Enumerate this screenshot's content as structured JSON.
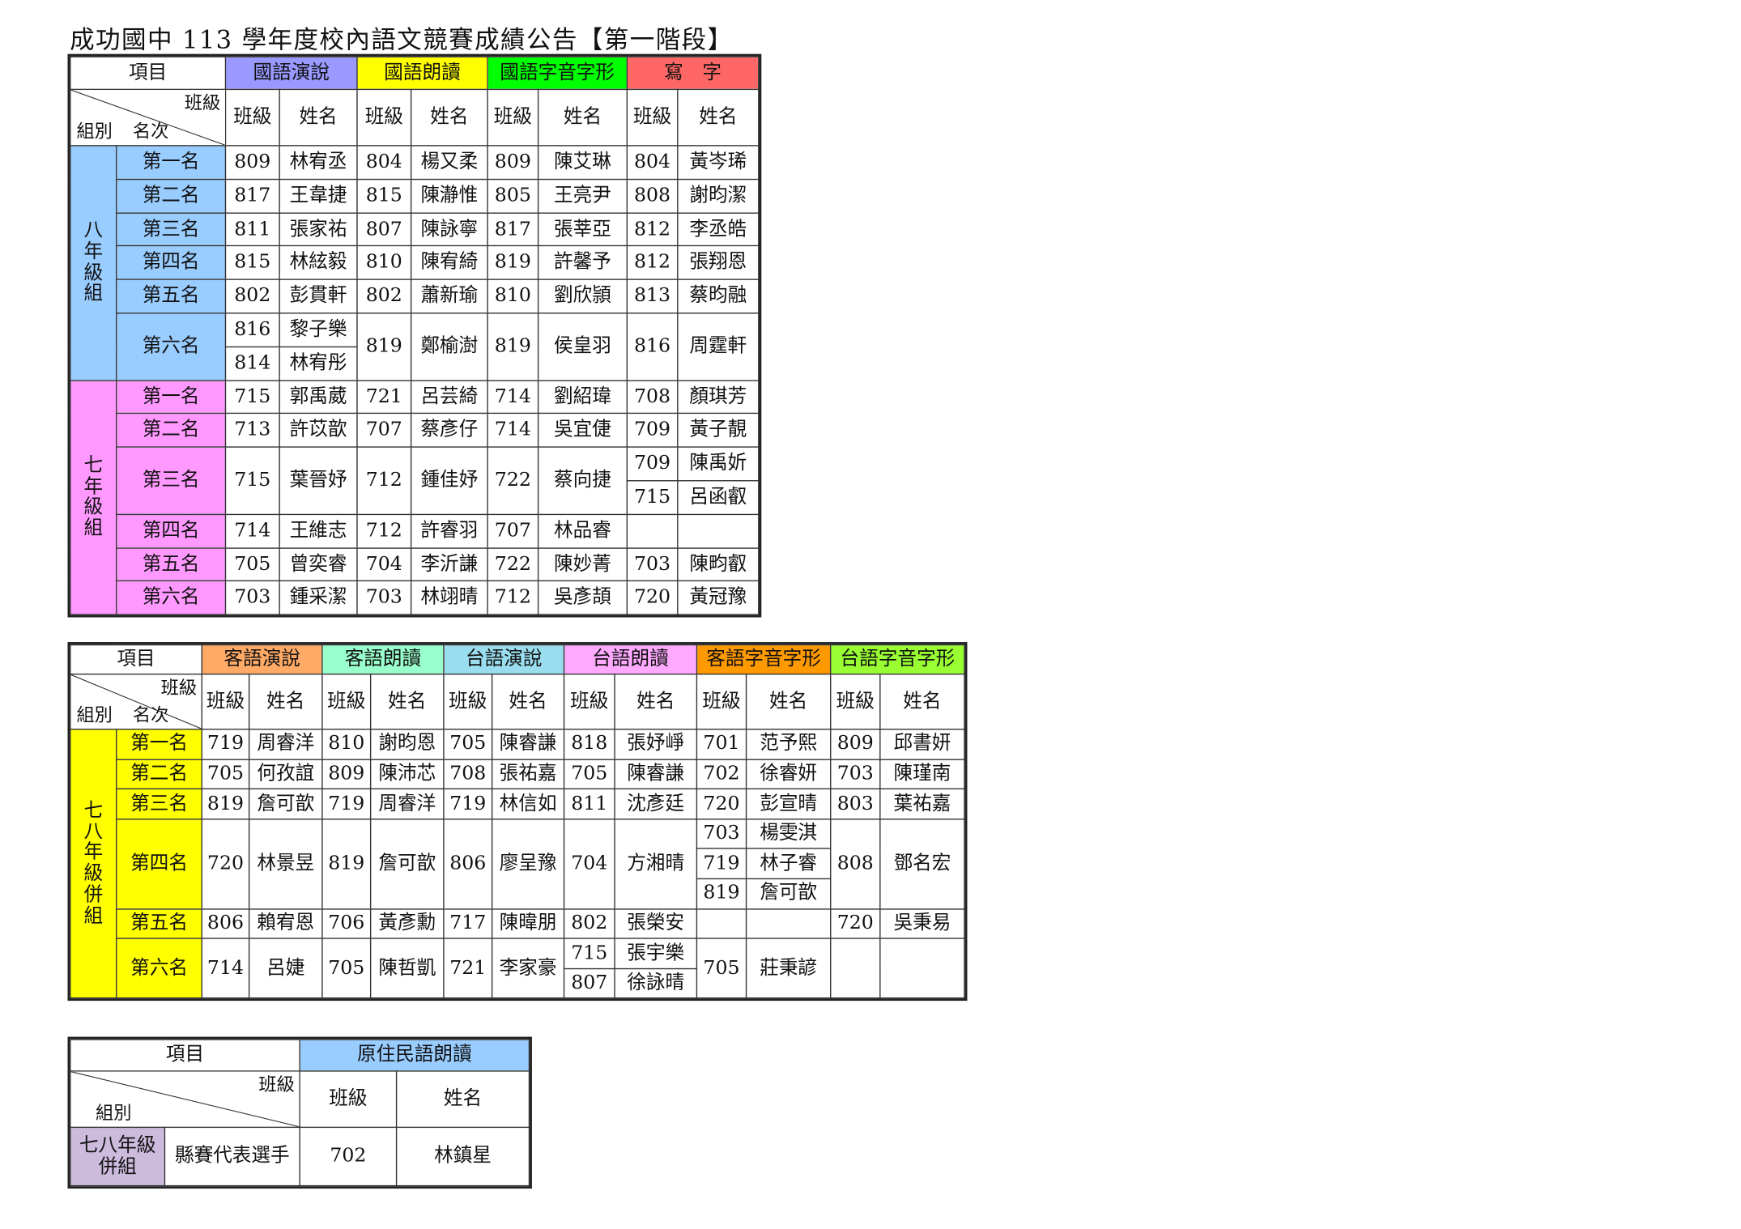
{
  "title": "成功國中 113 學年度校內語文競賽成績公告【第一階段】",
  "table1": {
    "project_label": "項目",
    "class_label": "班級",
    "group_label": "組別",
    "rank_label": "名次",
    "name_label": "姓名",
    "categories": [
      {
        "name": "國語演說",
        "color": "#9999ff"
      },
      {
        "name": "國語朗讀",
        "color": "#ffff00"
      },
      {
        "name": "國語字音字形",
        "color": "#00ff00"
      },
      {
        "name": "寫　字",
        "color": "#ff6666"
      }
    ],
    "groups": [
      {
        "name": "八年級組",
        "color": "#99ccff",
        "ranks": [
          {
            "rank": "第一名",
            "entries": [
              [
                [
                  "809",
                  "林宥丞"
                ]
              ],
              [
                [
                  "804",
                  "楊又柔"
                ]
              ],
              [
                [
                  "809",
                  "陳艾琳"
                ]
              ],
              [
                [
                  "804",
                  "黃岑琋"
                ]
              ]
            ]
          },
          {
            "rank": "第二名",
            "entries": [
              [
                [
                  "817",
                  "王韋捷"
                ]
              ],
              [
                [
                  "815",
                  "陳瀞惟"
                ]
              ],
              [
                [
                  "805",
                  "王亮尹"
                ]
              ],
              [
                [
                  "808",
                  "謝昀潔"
                ]
              ]
            ]
          },
          {
            "rank": "第三名",
            "entries": [
              [
                [
                  "811",
                  "張家祐"
                ]
              ],
              [
                [
                  "807",
                  "陳詠寧"
                ]
              ],
              [
                [
                  "817",
                  "張莘亞"
                ]
              ],
              [
                [
                  "812",
                  "李丞皓"
                ]
              ]
            ]
          },
          {
            "rank": "第四名",
            "entries": [
              [
                [
                  "815",
                  "林絃毅"
                ]
              ],
              [
                [
                  "810",
                  "陳宥綺"
                ]
              ],
              [
                [
                  "819",
                  "許馨予"
                ]
              ],
              [
                [
                  "812",
                  "張翔恩"
                ]
              ]
            ]
          },
          {
            "rank": "第五名",
            "entries": [
              [
                [
                  "802",
                  "彭貫軒"
                ]
              ],
              [
                [
                  "802",
                  "蕭新瑜"
                ]
              ],
              [
                [
                  "810",
                  "劉欣頴"
                ]
              ],
              [
                [
                  "813",
                  "蔡昀融"
                ]
              ]
            ]
          },
          {
            "rank": "第六名",
            "entries": [
              [
                [
                  "816",
                  "黎子樂"
                ],
                [
                  "814",
                  "林宥彤"
                ]
              ],
              [
                [
                  "819",
                  "鄭榆澍"
                ]
              ],
              [
                [
                  "819",
                  "侯皇羽"
                ]
              ],
              [
                [
                  "816",
                  "周霆軒"
                ]
              ]
            ]
          }
        ]
      },
      {
        "name": "七年級組",
        "color": "#ff99ff",
        "ranks": [
          {
            "rank": "第一名",
            "entries": [
              [
                [
                  "715",
                  "郭禹葳"
                ]
              ],
              [
                [
                  "721",
                  "呂芸綺"
                ]
              ],
              [
                [
                  "714",
                  "劉紹瑋"
                ]
              ],
              [
                [
                  "708",
                  "顏琪芳"
                ]
              ]
            ]
          },
          {
            "rank": "第二名",
            "entries": [
              [
                [
                  "713",
                  "許苡歆"
                ]
              ],
              [
                [
                  "707",
                  "蔡彥仔"
                ]
              ],
              [
                [
                  "714",
                  "吳宜倢"
                ]
              ],
              [
                [
                  "709",
                  "黃子靚"
                ]
              ]
            ]
          },
          {
            "rank": "第三名",
            "entries": [
              [
                [
                  "715",
                  "葉晉妤"
                ]
              ],
              [
                [
                  "712",
                  "鍾佳妤"
                ]
              ],
              [
                [
                  "722",
                  "蔡向捷"
                ]
              ],
              [
                [
                  "709",
                  "陳禹妡"
                ],
                [
                  "715",
                  "呂函叡"
                ]
              ]
            ]
          },
          {
            "rank": "第四名",
            "entries": [
              [
                [
                  "714",
                  "王維志"
                ]
              ],
              [
                [
                  "712",
                  "許睿羽"
                ]
              ],
              [
                [
                  "707",
                  "林品睿"
                ]
              ],
              [
                [
                  "",
                  ""
                ]
              ]
            ]
          },
          {
            "rank": "第五名",
            "entries": [
              [
                [
                  "705",
                  "曾奕睿"
                ]
              ],
              [
                [
                  "704",
                  "李沂謙"
                ]
              ],
              [
                [
                  "722",
                  "陳妙菁"
                ]
              ],
              [
                [
                  "703",
                  "陳畇叡"
                ]
              ]
            ]
          },
          {
            "rank": "第六名",
            "entries": [
              [
                [
                  "703",
                  "鍾采潔"
                ]
              ],
              [
                [
                  "703",
                  "林翊晴"
                ]
              ],
              [
                [
                  "712",
                  "吳彥頡"
                ]
              ],
              [
                [
                  "720",
                  "黃冠豫"
                ]
              ]
            ]
          }
        ]
      }
    ]
  },
  "table2": {
    "project_label": "項目",
    "class_label": "班級",
    "group_label": "組別",
    "rank_label": "名次",
    "name_label": "姓名",
    "categories": [
      {
        "name": "客語演說",
        "color": "#ffaa66"
      },
      {
        "name": "客語朗讀",
        "color": "#99ffcc"
      },
      {
        "name": "台語演說",
        "color": "#99ddee"
      },
      {
        "name": "台語朗讀",
        "color": "#ffaaff"
      },
      {
        "name": "客語字音字形",
        "color": "#ff9900"
      },
      {
        "name": "台語字音字形",
        "color": "#99ff33"
      }
    ],
    "group": {
      "name": "七八年級併組",
      "color": "#ffff00",
      "ranks": [
        {
          "rank": "第一名",
          "entries": [
            [
              [
                "719",
                "周睿洋"
              ]
            ],
            [
              [
                "810",
                "謝昀恩"
              ]
            ],
            [
              [
                "705",
                "陳睿謙"
              ]
            ],
            [
              [
                "818",
                "張妤崢"
              ]
            ],
            [
              [
                "701",
                "范予熙"
              ]
            ],
            [
              [
                "809",
                "邱書妍"
              ]
            ]
          ]
        },
        {
          "rank": "第二名",
          "entries": [
            [
              [
                "705",
                "何孜誼"
              ]
            ],
            [
              [
                "809",
                "陳沛芯"
              ]
            ],
            [
              [
                "708",
                "張祐嘉"
              ]
            ],
            [
              [
                "705",
                "陳睿謙"
              ]
            ],
            [
              [
                "702",
                "徐睿妍"
              ]
            ],
            [
              [
                "703",
                "陳瑾南"
              ]
            ]
          ]
        },
        {
          "rank": "第三名",
          "entries": [
            [
              [
                "819",
                "詹可歆"
              ]
            ],
            [
              [
                "719",
                "周睿洋"
              ]
            ],
            [
              [
                "719",
                "林信如"
              ]
            ],
            [
              [
                "811",
                "沈彥廷"
              ]
            ],
            [
              [
                "720",
                "彭宣晴"
              ]
            ],
            [
              [
                "803",
                "葉祐嘉"
              ]
            ]
          ]
        },
        {
          "rank": "第四名",
          "entries": [
            [
              [
                "720",
                "林景昱"
              ]
            ],
            [
              [
                "819",
                "詹可歆"
              ]
            ],
            [
              [
                "806",
                "廖呈豫"
              ]
            ],
            [
              [
                "704",
                "方湘晴"
              ]
            ],
            [
              [
                "703",
                "楊雯淇"
              ],
              [
                "719",
                "林子睿"
              ],
              [
                "819",
                "詹可歆"
              ]
            ],
            [
              [
                "808",
                "鄧名宏"
              ]
            ]
          ]
        },
        {
          "rank": "第五名",
          "entries": [
            [
              [
                "806",
                "賴宥恩"
              ]
            ],
            [
              [
                "706",
                "黃彥勳"
              ]
            ],
            [
              [
                "717",
                "陳暐朋"
              ]
            ],
            [
              [
                "802",
                "張榮安"
              ]
            ],
            [
              [
                "",
                ""
              ]
            ],
            [
              [
                "720",
                "吳秉易"
              ]
            ]
          ]
        },
        {
          "rank": "第六名",
          "entries": [
            [
              [
                "714",
                "呂婕"
              ]
            ],
            [
              [
                "705",
                "陳哲凱"
              ]
            ],
            [
              [
                "721",
                "李家豪"
              ]
            ],
            [
              [
                "715",
                "張宇樂"
              ],
              [
                "807",
                "徐詠晴"
              ]
            ],
            [
              [
                "705",
                "莊秉諺"
              ]
            ],
            [
              [
                "",
                ""
              ]
            ]
          ]
        }
      ]
    }
  },
  "table3": {
    "project_label": "項目",
    "category": {
      "name": "原住民語朗讀",
      "color": "#99ccff"
    },
    "class_label": "班級",
    "group_label": "組別",
    "name_label": "姓名",
    "group_name": "七八年級併組",
    "group_color": "#ccbbdd",
    "role": "縣賽代表選手",
    "class_value": "702",
    "name_value": "林鎮星"
  }
}
